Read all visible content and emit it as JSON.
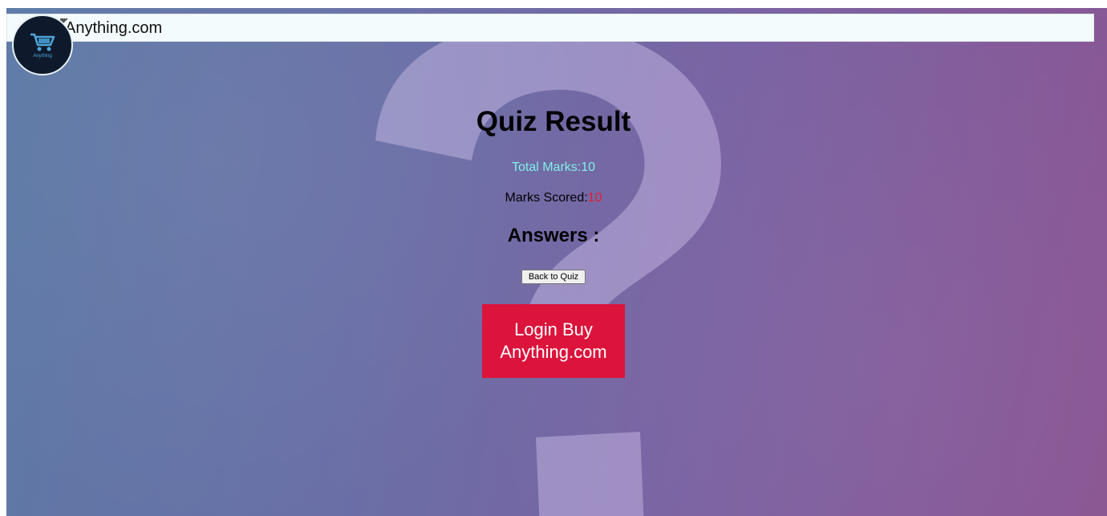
{
  "header": {
    "brand_label": "Anything.com",
    "logo_text": "Anything"
  },
  "quiz": {
    "title": "Quiz Result",
    "total_label": "Total Marks:",
    "total_value": "10",
    "scored_label": "Marks Scored:",
    "scored_value": "10",
    "answers_heading": "Answers :"
  },
  "actions": {
    "back_label": "Back to Quiz",
    "login_label": "Login Buy Anything.com"
  },
  "colors": {
    "accent_red": "#dc143c",
    "total_color": "#7ff0e6",
    "score_value_color": "#e02030"
  },
  "icons": {
    "logo": "shopping-cart-icon",
    "background": "question-mark-icon"
  }
}
